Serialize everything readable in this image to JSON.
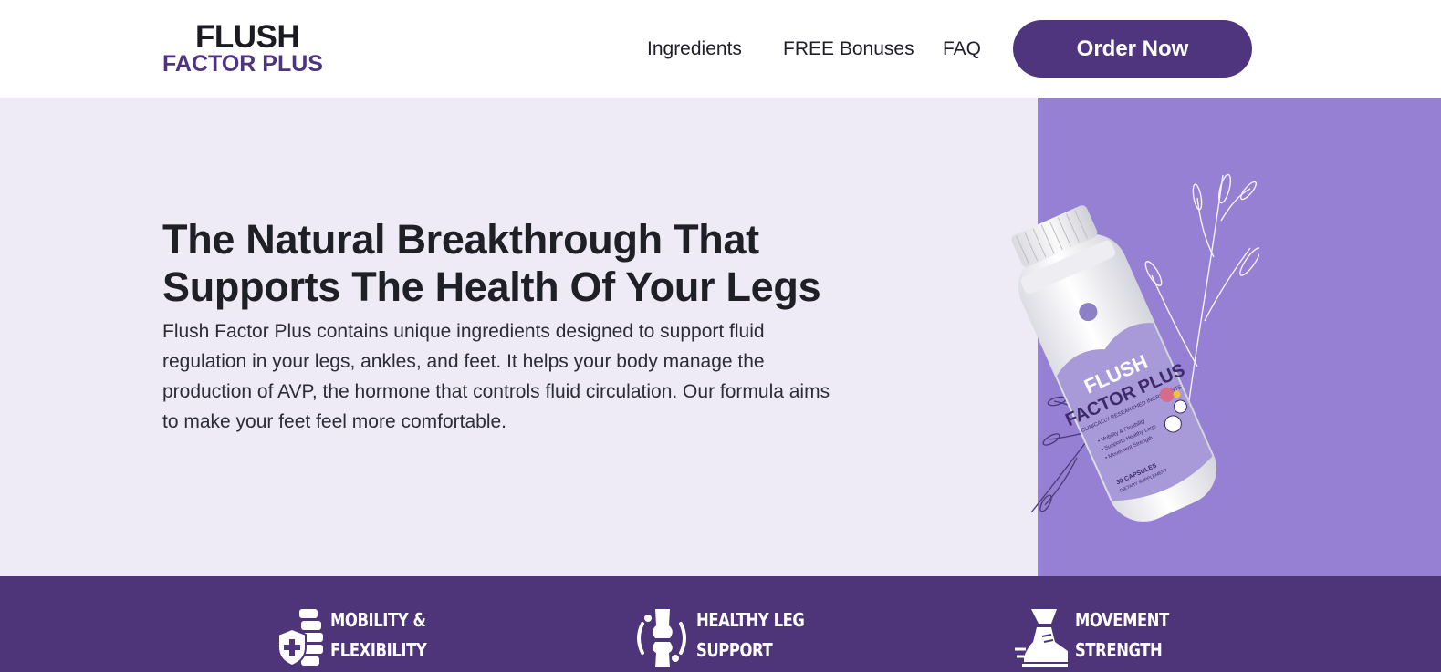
{
  "header": {
    "logo_top": "FLUSH",
    "logo_bottom": "FACTOR PLUS",
    "nav": [
      "Ingredients",
      "FREE Bonuses",
      "FAQ"
    ],
    "order_button": "Order Now"
  },
  "hero": {
    "title_line1": "The Natural Breakthrough That",
    "title_line2": "Supports The Health Of Your Legs",
    "description": "Flush Factor Plus contains unique ingredients designed to support fluid regulation in your legs, ankles, and feet. It helps your body manage the production of AVP, the hormone that controls fluid circulation. Our formula aims to make your feet feel more comfortable.",
    "product_label_top": "FLUSH",
    "product_label_bottom": "FACTOR PLUS",
    "product_subtitle": "CLINICALLY RESEARCHED INGREDIENTS",
    "product_bullets": [
      "• Mobility & Flexibility",
      "• Supports Healthy Legs",
      "• Movement Strength"
    ],
    "product_count": "30 CAPSULES",
    "product_type": "DIETARY SUPPLEMENT"
  },
  "benefits": [
    {
      "line1": "MOBILITY &",
      "line2": "FLEXIBILITY",
      "icon": "spine-shield-icon"
    },
    {
      "line1": "HEALTHY LEG",
      "line2": "SUPPORT",
      "icon": "knee-joint-icon"
    },
    {
      "line1": "MOVEMENT",
      "line2": "STRENGTH",
      "icon": "running-shoe-icon"
    }
  ],
  "colors": {
    "brand_purple": "#4f357e",
    "hero_bg": "#eeebf7",
    "hero_side": "#9580d4"
  }
}
